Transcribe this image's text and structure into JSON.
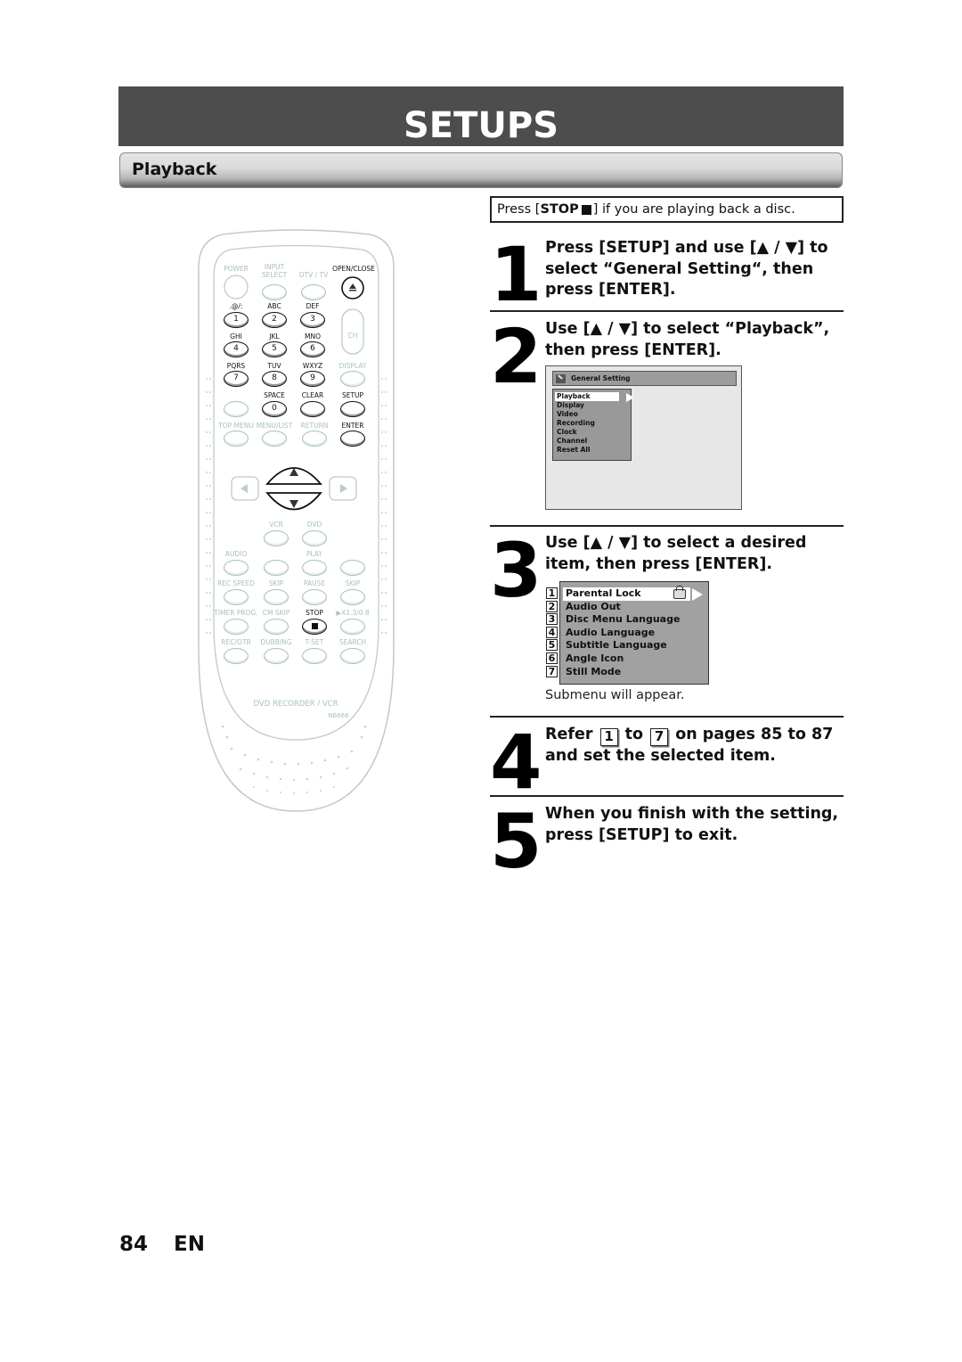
{
  "header": {
    "title": "SETUPS",
    "section": "Playback"
  },
  "notice": {
    "prefix": "Press [",
    "button": "STOP",
    "suffix": "] if you are playing back a disc."
  },
  "steps": [
    {
      "number": "1",
      "text": "Press [SETUP] and use [▲ / ▼] to select “General Setting“, then press [ENTER]."
    },
    {
      "number": "2",
      "text": "Use [▲ / ▼] to select “Playback”, then press [ENTER]."
    },
    {
      "number": "3",
      "text": "Use [▲ / ▼] to select a desired item, then press [ENTER]."
    },
    {
      "number": "4",
      "text_a": "Refer",
      "ref_from": "1",
      "text_b": "to",
      "ref_to": "7",
      "text_c": "on pages 85 to 87 and set the selected item."
    },
    {
      "number": "5",
      "text": "When you finish with the setting, press [SETUP] to exit."
    }
  ],
  "general_setting_screen": {
    "title": "General Setting",
    "items": [
      "Playback",
      "Display",
      "Video",
      "Recording",
      "Clock",
      "Channel",
      "Reset All"
    ],
    "selected": "Playback"
  },
  "playback_screen": {
    "items": [
      "Parental Lock",
      "Audio Out",
      "Disc Menu Language",
      "Audio Language",
      "Subtitle Language",
      "Angle Icon",
      "Still Mode"
    ],
    "numbers": [
      "1",
      "2",
      "3",
      "4",
      "5",
      "6",
      "7"
    ],
    "selected": "Parental Lock"
  },
  "submenu_note": "Submenu will appear.",
  "footer": {
    "page_number": "84",
    "language": "EN"
  },
  "remote": {
    "labels": {
      "power": "POWER",
      "input_select_1": "INPUT",
      "input_select_2": "SELECT",
      "dtv_tv": "DTV / TV",
      "open_close": "OPEN/CLOSE",
      "k1_letters": ".@/:",
      "k2_letters": "ABC",
      "k3_letters": "DEF",
      "k4_letters": "GHI",
      "k5_letters": "JKL",
      "k6_letters": "MNO",
      "k7_letters": "PQRS",
      "k8_letters": "TUV",
      "k9_letters": "WXYZ",
      "ch": "CH",
      "display": "DISPLAY",
      "space": "SPACE",
      "clear": "CLEAR",
      "setup": "SETUP",
      "top_menu": "TOP MENU",
      "menu_list": "MENU/LIST",
      "return": "RETURN",
      "enter": "ENTER",
      "vcr": "VCR",
      "dvd": "DVD",
      "audio": "AUDIO",
      "play": "PLAY",
      "rec_speed": "REC SPEED",
      "skip_back": "SKIP",
      "pause": "PAUSE",
      "skip_fwd": "SKIP",
      "timer_prog": "TIMER PROG.",
      "cm_skip": "CM SKIP",
      "stop": "STOP",
      "speed": "▶X1.3/0.8",
      "rec_otr": "REC/OTR",
      "dubbing": "DUBBING",
      "t_set": "T-SET",
      "search": "SEARCH",
      "brand": "DVD RECORDER / VCR",
      "model": "NB666"
    },
    "digits": [
      "1",
      "2",
      "3",
      "4",
      "5",
      "6",
      "7",
      "8",
      "9",
      "0"
    ]
  }
}
